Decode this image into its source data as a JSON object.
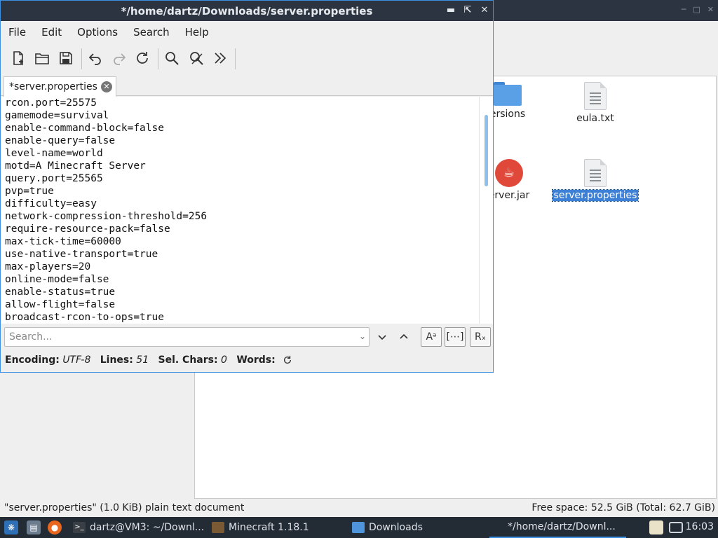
{
  "file_manager": {
    "items": [
      {
        "label": "ersions",
        "icon": "folder-icon"
      },
      {
        "label": "eula.txt",
        "icon": "text-file-icon"
      },
      {
        "label": "erver.jar",
        "icon": "java-icon"
      },
      {
        "label": "server.properties",
        "icon": "text-file-icon"
      }
    ],
    "status_left": "\"server.properties\" (1.0 KiB) plain text document",
    "status_right": "Free space: 52.5 GiB (Total: 62.7 GiB)"
  },
  "editor": {
    "title": "*/home/dartz/Downloads/server.properties",
    "menu": [
      "File",
      "Edit",
      "Options",
      "Search",
      "Help"
    ],
    "tab_label": "*server.properties",
    "lines": [
      "rcon.port=25575",
      "gamemode=survival",
      "enable-command-block=false",
      "enable-query=false",
      "level-name=world",
      "motd=A Minecraft Server",
      "query.port=25565",
      "pvp=true",
      "difficulty=easy",
      "network-compression-threshold=256",
      "require-resource-pack=false",
      "max-tick-time=60000",
      "use-native-transport=true",
      "max-players=20",
      "online-mode=false",
      "enable-status=true",
      "allow-flight=false",
      "broadcast-rcon-to-ops=true"
    ],
    "search_placeholder": "Search...",
    "status": {
      "encoding_label": "Encoding:",
      "encoding_value": "UTF-8",
      "lines_label": "Lines:",
      "lines_value": "51",
      "selchars_label": "Sel. Chars:",
      "selchars_value": "0",
      "words_label": "Words:"
    }
  },
  "taskbar": {
    "tasks": [
      {
        "label": "dartz@VM3: ~/Downl..."
      },
      {
        "label": "Minecraft 1.18.1"
      },
      {
        "label": "Downloads"
      },
      {
        "label": "*/home/dartz/Downl..."
      }
    ],
    "clock": "16:03"
  },
  "colors": {
    "accent": "#3d8fe0",
    "titlebar": "#2b3440",
    "selection": "#3d80d6"
  }
}
